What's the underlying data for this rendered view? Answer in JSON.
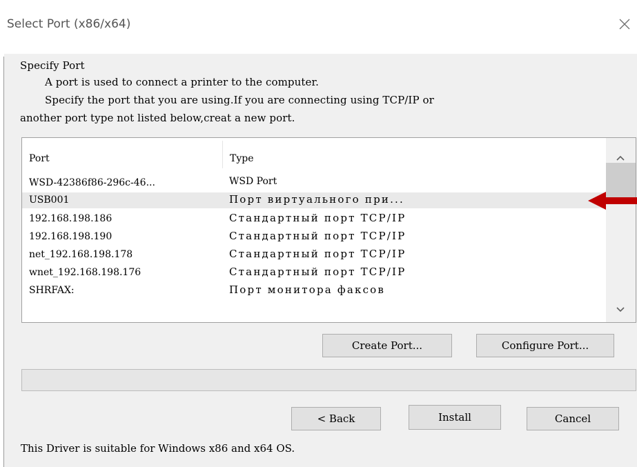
{
  "window": {
    "title": "Select Port (x86/x64)",
    "close_icon": "close-icon"
  },
  "instructions": {
    "heading": "Specify Port",
    "line1": "A port is used to connect a printer to the computer.",
    "line2": "Specify the port that you are using.If you are connecting using TCP/IP or",
    "line3": "another port type not listed below,creat a new port."
  },
  "port_list": {
    "columns": [
      "Port",
      "Type"
    ],
    "rows": [
      {
        "port": "WSD-42386f86-296c-46...",
        "type": "WSD Port",
        "highlighted": false
      },
      {
        "port": "USB001",
        "type": "Порт виртуального при...",
        "highlighted": true
      },
      {
        "port": "192.168.198.186",
        "type": "Стандартный порт TCP/IP",
        "highlighted": false
      },
      {
        "port": "192.168.198.190",
        "type": "Стандартный порт TCP/IP",
        "highlighted": false
      },
      {
        "port": "net_192.168.198.178",
        "type": "Стандартный порт TCP/IP",
        "highlighted": false
      },
      {
        "port": "wnet_192.168.198.176",
        "type": "Стандартный порт TCP/IP",
        "highlighted": false
      },
      {
        "port": "SHRFAX:",
        "type": "Порт монитора факсов",
        "highlighted": false
      }
    ]
  },
  "buttons": {
    "create_port": "Create Port...",
    "configure_port": "Configure Port...",
    "back": "< Back",
    "install": "Install",
    "cancel": "Cancel"
  },
  "footer": {
    "note": "This Driver is suitable for Windows x86 and x64 OS."
  },
  "colors": {
    "highlight_row": "#e9e9e9",
    "annotation_arrow": "#c00000",
    "dialog_bg": "#f0f0f0"
  }
}
